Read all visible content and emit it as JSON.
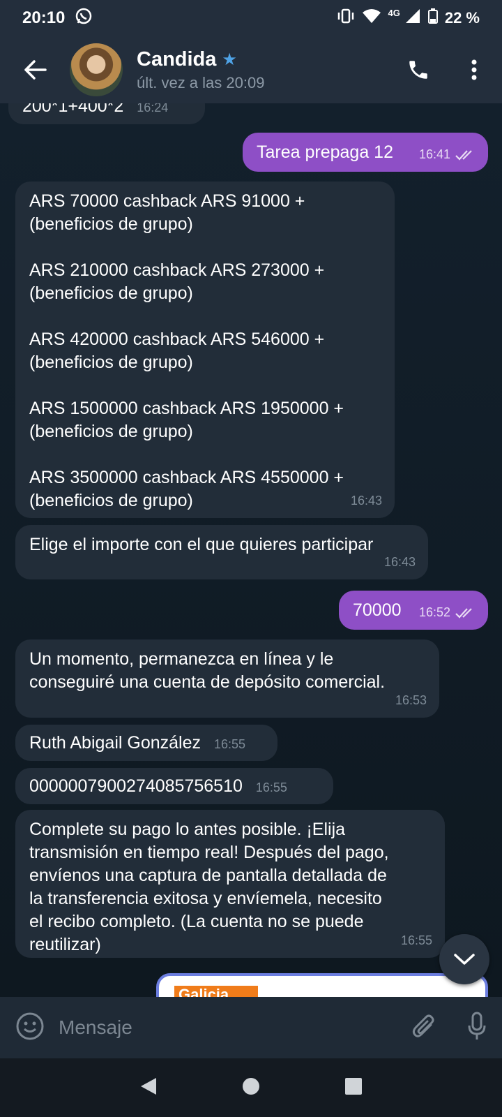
{
  "status": {
    "time": "20:10",
    "network": "4G",
    "battery": "22 %"
  },
  "header": {
    "name": "Candida",
    "last_seen": "últ. vez a las 20:09",
    "verified_icon": "star-icon"
  },
  "messages": [
    {
      "dir": "in",
      "text": "200*1+400*2",
      "time": "16:24"
    },
    {
      "dir": "out",
      "text": "Tarea prepaga 12",
      "time": "16:41"
    },
    {
      "dir": "in",
      "text": "ARS 70000 cashback ARS 91000 +\n(beneficios de grupo)\n\nARS 210000 cashback ARS 273000 +\n(beneficios de grupo)\n\nARS 420000 cashback ARS 546000 +\n(beneficios de grupo)\n\nARS 1500000 cashback ARS 1950000 +\n(beneficios de grupo)\n\nARS 3500000 cashback ARS 4550000 +\n(beneficios de grupo)",
      "time": "16:43"
    },
    {
      "dir": "in",
      "text": "Elige el importe con el que quieres participar",
      "time": "16:43"
    },
    {
      "dir": "out",
      "text": "70000",
      "time": "16:52"
    },
    {
      "dir": "in",
      "text": "Un momento, permanezca en línea y le\nconseguiré una cuenta de depósito comercial.",
      "time": "16:53"
    },
    {
      "dir": "in",
      "text": "Ruth Abigail González",
      "time": "16:55"
    },
    {
      "dir": "in",
      "text": "0000007900274085756510",
      "time": "16:55"
    },
    {
      "dir": "in",
      "text": "Complete su pago lo antes posible. ¡Elija\ntransmisión en tiempo real! Después del pago,\nenvíenos una captura de pantalla detallada de\nla transferencia exitosa y envíemela, necesito\nel recibo completo. (La cuenta no se puede\nreutilizar)",
      "time": "16:55"
    }
  ],
  "image_preview": {
    "label": "Galicia"
  },
  "input": {
    "placeholder": "Mensaje"
  },
  "colors": {
    "incoming": "#222d39",
    "outgoing": "#8e4fc6",
    "header": "#232e3c",
    "accent": "#4fa3e6"
  }
}
